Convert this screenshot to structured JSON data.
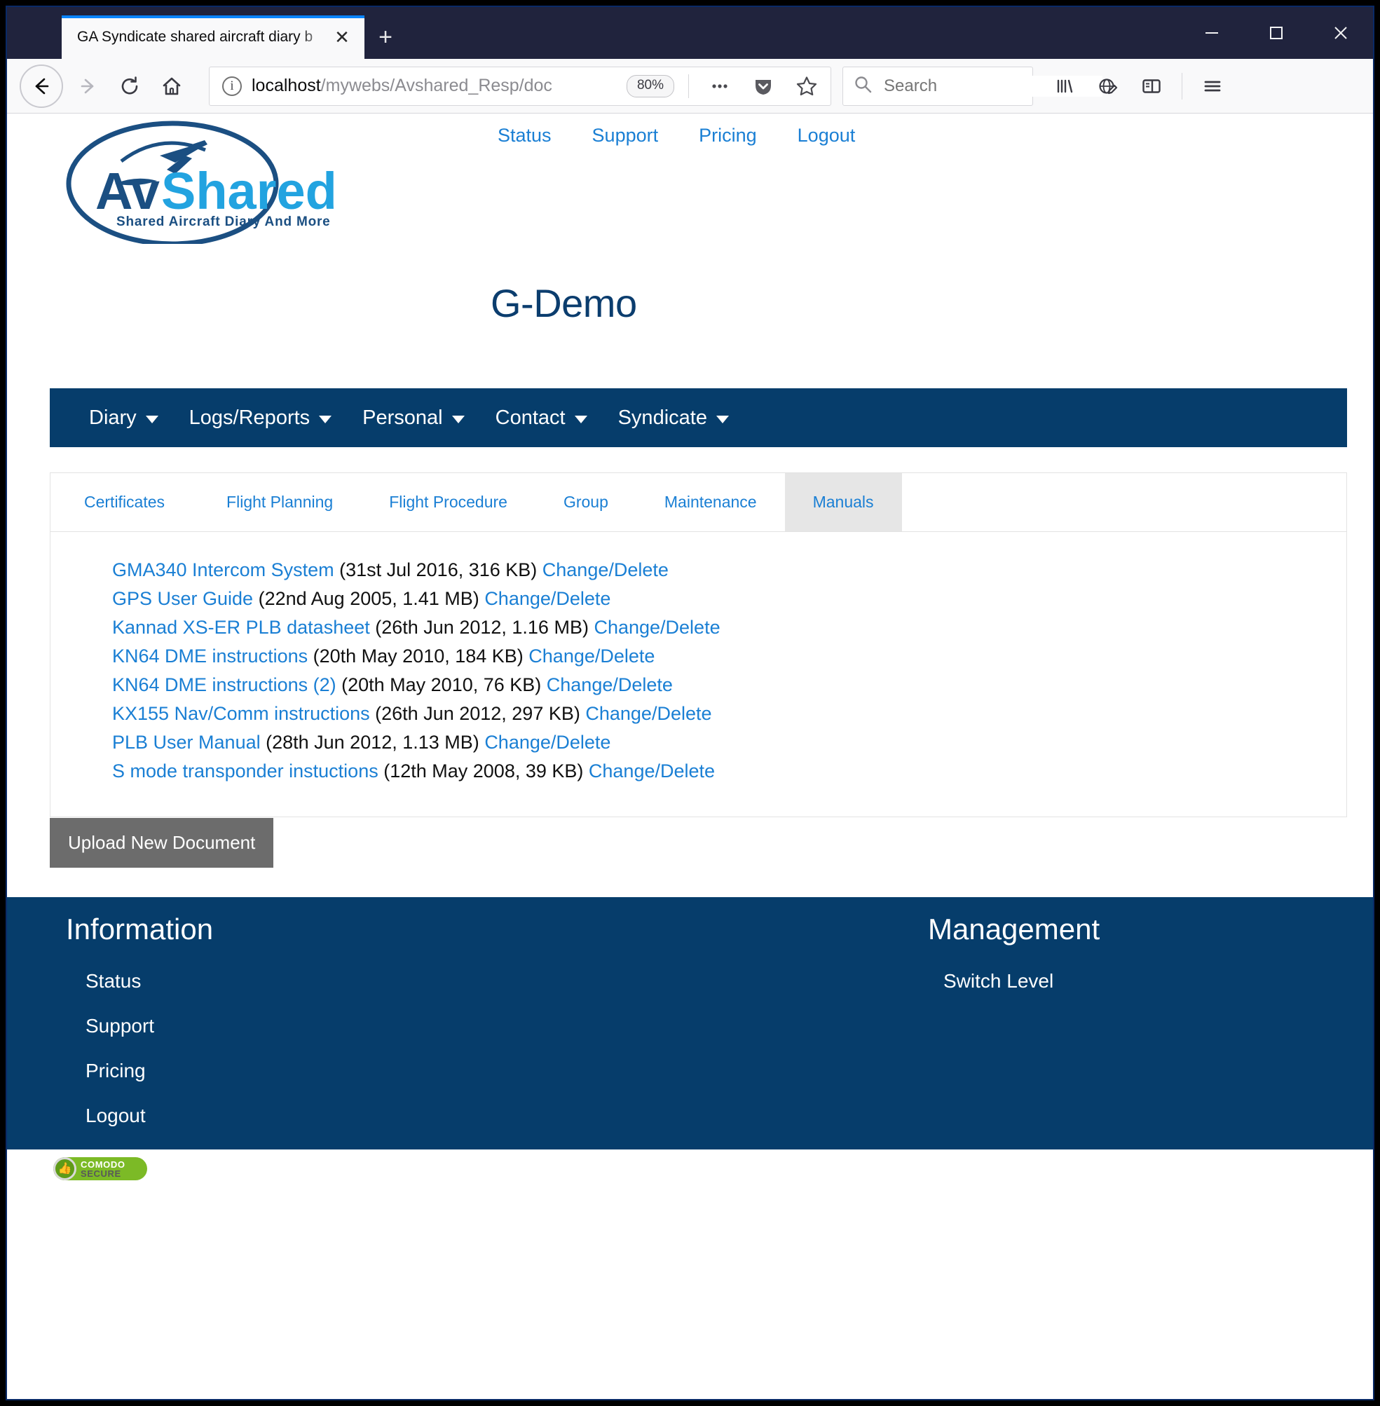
{
  "browser": {
    "tab_title": "GA Syndicate shared aircraft diary b",
    "tab_close_glyph": "✕",
    "newtab_glyph": "+",
    "url_host": "localhost",
    "url_path": "/mywebs/Avshared_Resp/doc",
    "zoom_level": "80%",
    "search_placeholder": "Search",
    "icons": {
      "back": "back-arrow-icon",
      "forward": "forward-arrow-icon",
      "reload": "reload-icon",
      "home": "home-icon",
      "info": "page-info-icon",
      "page_actions": "ellipsis-icon",
      "pocket": "pocket-icon",
      "bookmark": "star-icon",
      "search": "search-icon",
      "library": "library-icon",
      "account": "account-globe-pencil-icon",
      "sidebar": "sidebar-icon",
      "menu": "hamburger-menu-icon",
      "minimize": "minimize-icon",
      "maximize": "maximize-icon",
      "close": "close-icon"
    }
  },
  "site": {
    "logo_alt": "AvShared",
    "logo_word_1": "Av",
    "logo_word_2": "Shared",
    "logo_tagline": "Shared Aircraft Diary And More",
    "top_links": [
      "Status",
      "Support",
      "Pricing",
      "Logout"
    ],
    "page_title": "G-Demo",
    "main_nav": [
      "Diary",
      "Logs/Reports",
      "Personal",
      "Contact",
      "Syndicate"
    ]
  },
  "panel": {
    "tabs": [
      {
        "label": "Certificates",
        "active": false
      },
      {
        "label": "Flight Planning",
        "active": false
      },
      {
        "label": "Flight Procedure",
        "active": false
      },
      {
        "label": "Group",
        "active": false
      },
      {
        "label": "Maintenance",
        "active": false
      },
      {
        "label": "Manuals",
        "active": true
      }
    ],
    "documents": [
      {
        "name": "GMA340 Intercom System",
        "meta": "(31st Jul 2016, 316 KB)",
        "action": "Change/Delete"
      },
      {
        "name": "GPS User Guide",
        "meta": "(22nd Aug 2005, 1.41 MB)",
        "action": "Change/Delete"
      },
      {
        "name": "Kannad XS-ER PLB datasheet",
        "meta": "(26th Jun 2012, 1.16 MB)",
        "action": "Change/Delete"
      },
      {
        "name": "KN64 DME instructions",
        "meta": "(20th May 2010, 184 KB)",
        "action": "Change/Delete"
      },
      {
        "name": "KN64 DME instructions (2)",
        "meta": "(20th May 2010, 76 KB)",
        "action": "Change/Delete"
      },
      {
        "name": "KX155 Nav/Comm instructions",
        "meta": "(26th Jun 2012, 297 KB)",
        "action": "Change/Delete"
      },
      {
        "name": "PLB User Manual",
        "meta": "(28th Jun 2012, 1.13 MB)",
        "action": "Change/Delete"
      },
      {
        "name": "S mode transponder instuctions",
        "meta": "(12th May 2008, 39 KB)",
        "action": "Change/Delete"
      }
    ],
    "upload_label": "Upload New Document"
  },
  "footer": {
    "information_heading": "Information",
    "information_links": [
      "Status",
      "Support",
      "Pricing",
      "Logout"
    ],
    "management_heading": "Management",
    "management_links": [
      "Switch Level"
    ],
    "badge": {
      "line1": "COMODO",
      "line2": "SECURE"
    }
  },
  "colors": {
    "brand_navy": "#063d6b",
    "link_blue": "#1a7fd4",
    "title_navy": "#0b3d6e",
    "button_gray": "#6c6c6c",
    "active_tab_gray": "#e6e6e6",
    "badge_green": "#7cba26"
  }
}
